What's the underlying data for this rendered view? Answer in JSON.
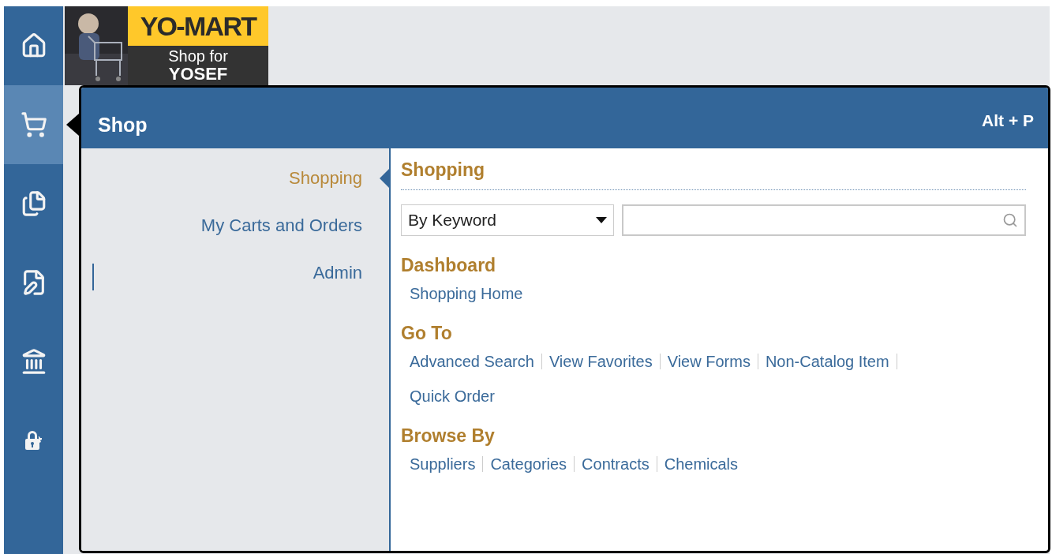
{
  "nav": [
    {
      "kind": "home",
      "selected": false
    },
    {
      "kind": "cart",
      "selected": true
    },
    {
      "kind": "documents",
      "selected": false
    },
    {
      "kind": "edit",
      "selected": false
    },
    {
      "kind": "bank",
      "selected": false
    },
    {
      "kind": "lock",
      "selected": false
    }
  ],
  "logo": {
    "title": "YO-MART",
    "line_1": "Shop for",
    "line_2": "YOSEF"
  },
  "panel": {
    "title": "Shop",
    "shortcut": "Alt + P",
    "menu": [
      {
        "label": "Shopping",
        "selected": true
      },
      {
        "label": "My Carts and Orders",
        "selected": false
      },
      {
        "label": "Admin",
        "selected": false
      }
    ],
    "heading": "Shopping",
    "search": {
      "mode": "By Keyword"
    },
    "sections": [
      {
        "title": "Dashboard",
        "rows": [
          [
            "Shopping Home"
          ]
        ]
      },
      {
        "title": "Go To",
        "rows": [
          [
            "Advanced Search",
            "View Favorites",
            "View Forms",
            "Non-Catalog Item"
          ],
          [
            "Quick Order"
          ]
        ],
        "trailing_separator": true
      },
      {
        "title": "Browse By",
        "rows": [
          [
            "Suppliers",
            "Categories",
            "Contracts",
            "Chemicals"
          ]
        ]
      }
    ]
  }
}
